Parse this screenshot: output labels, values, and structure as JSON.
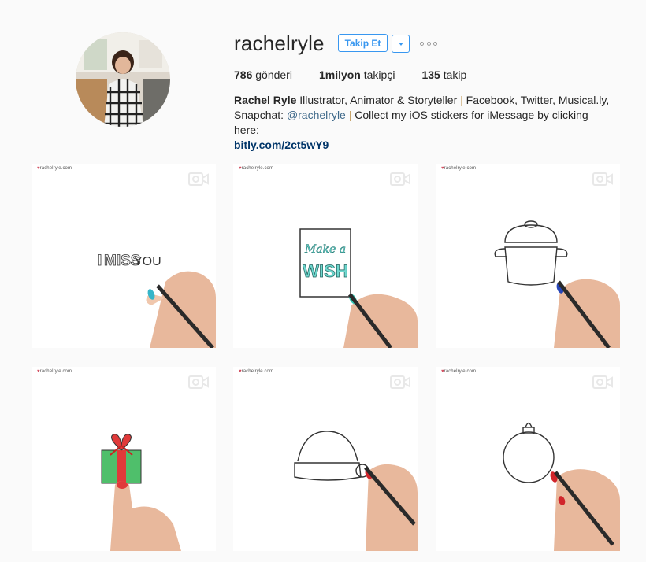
{
  "profile": {
    "username": "rachelryle",
    "follow_label": "Takip Et",
    "stats": {
      "posts_count": "786",
      "posts_label": "gönderi",
      "followers_count": "1milyon",
      "followers_label": "takipçi",
      "following_count": "135",
      "following_label": "takip"
    },
    "bio": {
      "full_name": "Rachel Ryle",
      "text1": " Illustrator, Animator & Storyteller ",
      "sep1": "|",
      "text2": " Facebook, Twitter, Musical.ly,",
      "text3": "Snapchat: ",
      "mention": "@rachelryle",
      "sep2": " | ",
      "text4": "Collect my iOS stickers for iMessage by clicking here:",
      "link": "bitly.com/2ct5wY9"
    }
  },
  "posts": [
    {
      "watermark": "rachelryle.com",
      "drawing": "i-miss-you",
      "text_a": "I",
      "text_b": "MISS",
      "text_c": "YOU"
    },
    {
      "watermark": "rachelryle.com",
      "drawing": "make-a-wish",
      "text_a": "Make a",
      "text_b": "WISH"
    },
    {
      "watermark": "rachelryle.com",
      "drawing": "pot"
    },
    {
      "watermark": "rachelryle.com",
      "drawing": "gift"
    },
    {
      "watermark": "rachelryle.com",
      "drawing": "santa-hat"
    },
    {
      "watermark": "rachelryle.com",
      "drawing": "ornament"
    }
  ],
  "colors": {
    "accent": "#3897f0",
    "link": "#003569",
    "separator": "#c7a46b"
  }
}
